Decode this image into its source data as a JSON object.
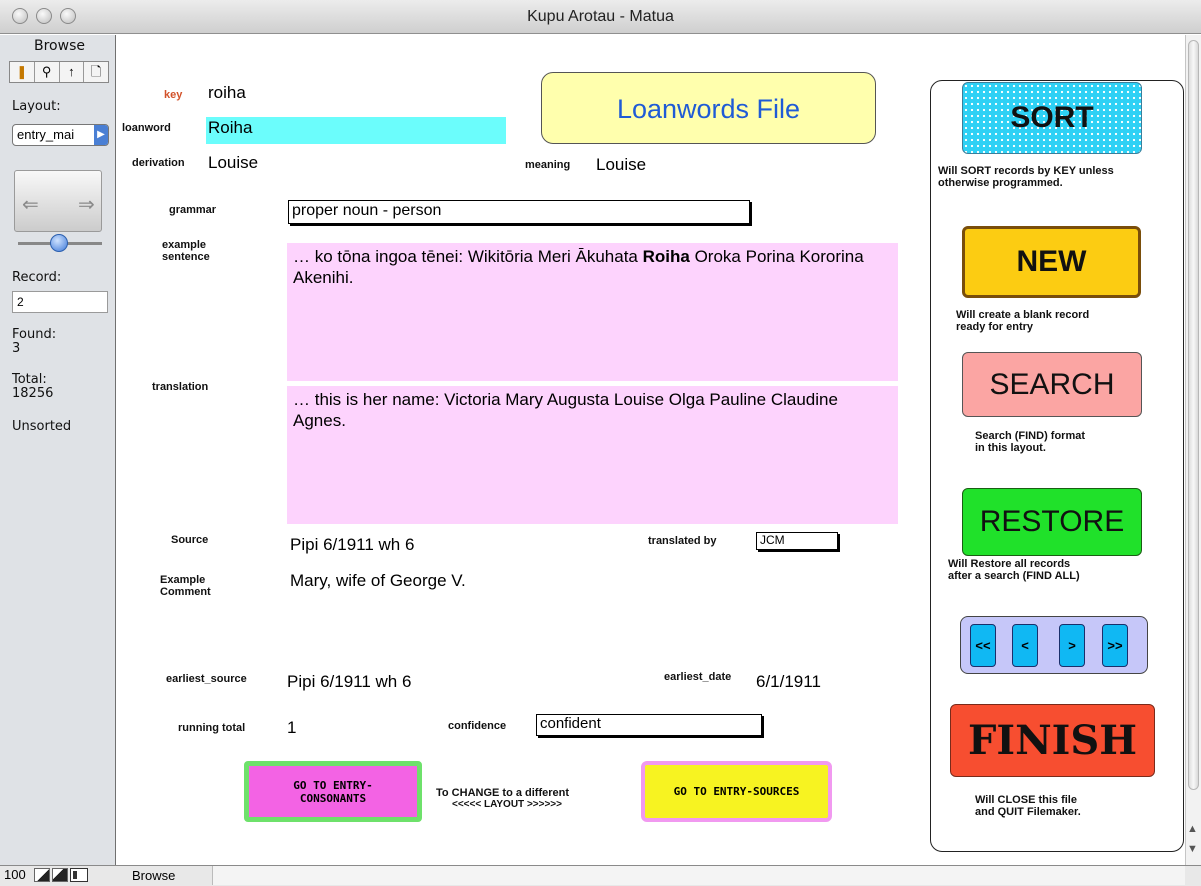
{
  "window": {
    "title": "Kupu Arotau - Matua"
  },
  "status": {
    "mode": "Browse",
    "layout_label": "Layout:",
    "layout_value": "entry_mai",
    "record_label": "Record:",
    "record_value": "2",
    "found_label": "Found:",
    "found_value": "3",
    "total_label": "Total:",
    "total_value": "18256",
    "sort_state": "Unsorted",
    "zoom": "100",
    "bottom_mode": "Browse"
  },
  "form": {
    "title": "Loanwords File",
    "key_label": "key",
    "key_value": "roiha",
    "loanword_label": "loanword",
    "loanword_value": "Roiha",
    "derivation_label": "derivation",
    "derivation_value": "Louise",
    "meaning_label": "meaning",
    "meaning_value": "Louise",
    "grammar_label": "grammar",
    "grammar_value": "proper noun - person",
    "example_label_1": "example",
    "example_label_2": "sentence",
    "example_before": "… ko tōna ingoa tēnei: Wikitōria Meri Ākuhata ",
    "example_bold": "Roiha",
    "example_after": " Oroka Porina Kororina Akenihi.",
    "translation_label": "translation",
    "translation_value": "… this is her name: Victoria Mary Augusta Louise Olga Pauline Claudine Agnes.",
    "source_label": "Source",
    "source_value": "Pipi 6/1911 wh 6",
    "translated_by_label": "translated by",
    "translated_by_value": "JCM",
    "example_comment_label_1": "Example",
    "example_comment_label_2": "Comment",
    "example_comment_value": "Mary, wife of George V.",
    "earliest_source_label": "earliest_source",
    "earliest_source_value": "Pipi 6/1911 wh 6",
    "earliest_date_label": "earliest_date",
    "earliest_date_value": "6/1/1911",
    "running_total_label": "running total",
    "running_total_value": "1",
    "confidence_label": "confidence",
    "confidence_value": "confident",
    "goto_consonants_1": "GO TO ENTRY-",
    "goto_consonants_2": "CONSONANTS",
    "change_note_1": "To CHANGE to a different",
    "change_note_2": "<<<<< LAYOUT >>>>>>",
    "goto_sources": "GO TO ENTRY-SOURCES"
  },
  "buttons": {
    "sort": "SORT",
    "sort_note_1": "Will SORT records by KEY unless",
    "sort_note_2": "otherwise programmed.",
    "new": "NEW",
    "new_note_1": "Will create a blank record",
    "new_note_2": "ready for entry",
    "search": "SEARCH",
    "search_note_1": "Search (FIND) format",
    "search_note_2": "in this layout.",
    "restore": "RESTORE",
    "restore_note_1": "Will Restore all records",
    "restore_note_2": "after a search  (FIND ALL)",
    "first": "<<",
    "prev": "<",
    "next": ">",
    "last": ">>",
    "finish": "FINISH",
    "finish_note_1": "Will CLOSE this file",
    "finish_note_2": "and QUIT Filemaker."
  },
  "colors": {
    "loanword_highlight": "#6bfdfc",
    "text_area_bg": "#fdd3fd",
    "title_panel_bg": "#ffffad",
    "title_text": "#1f5bd6",
    "key_label": "#d2522a"
  }
}
